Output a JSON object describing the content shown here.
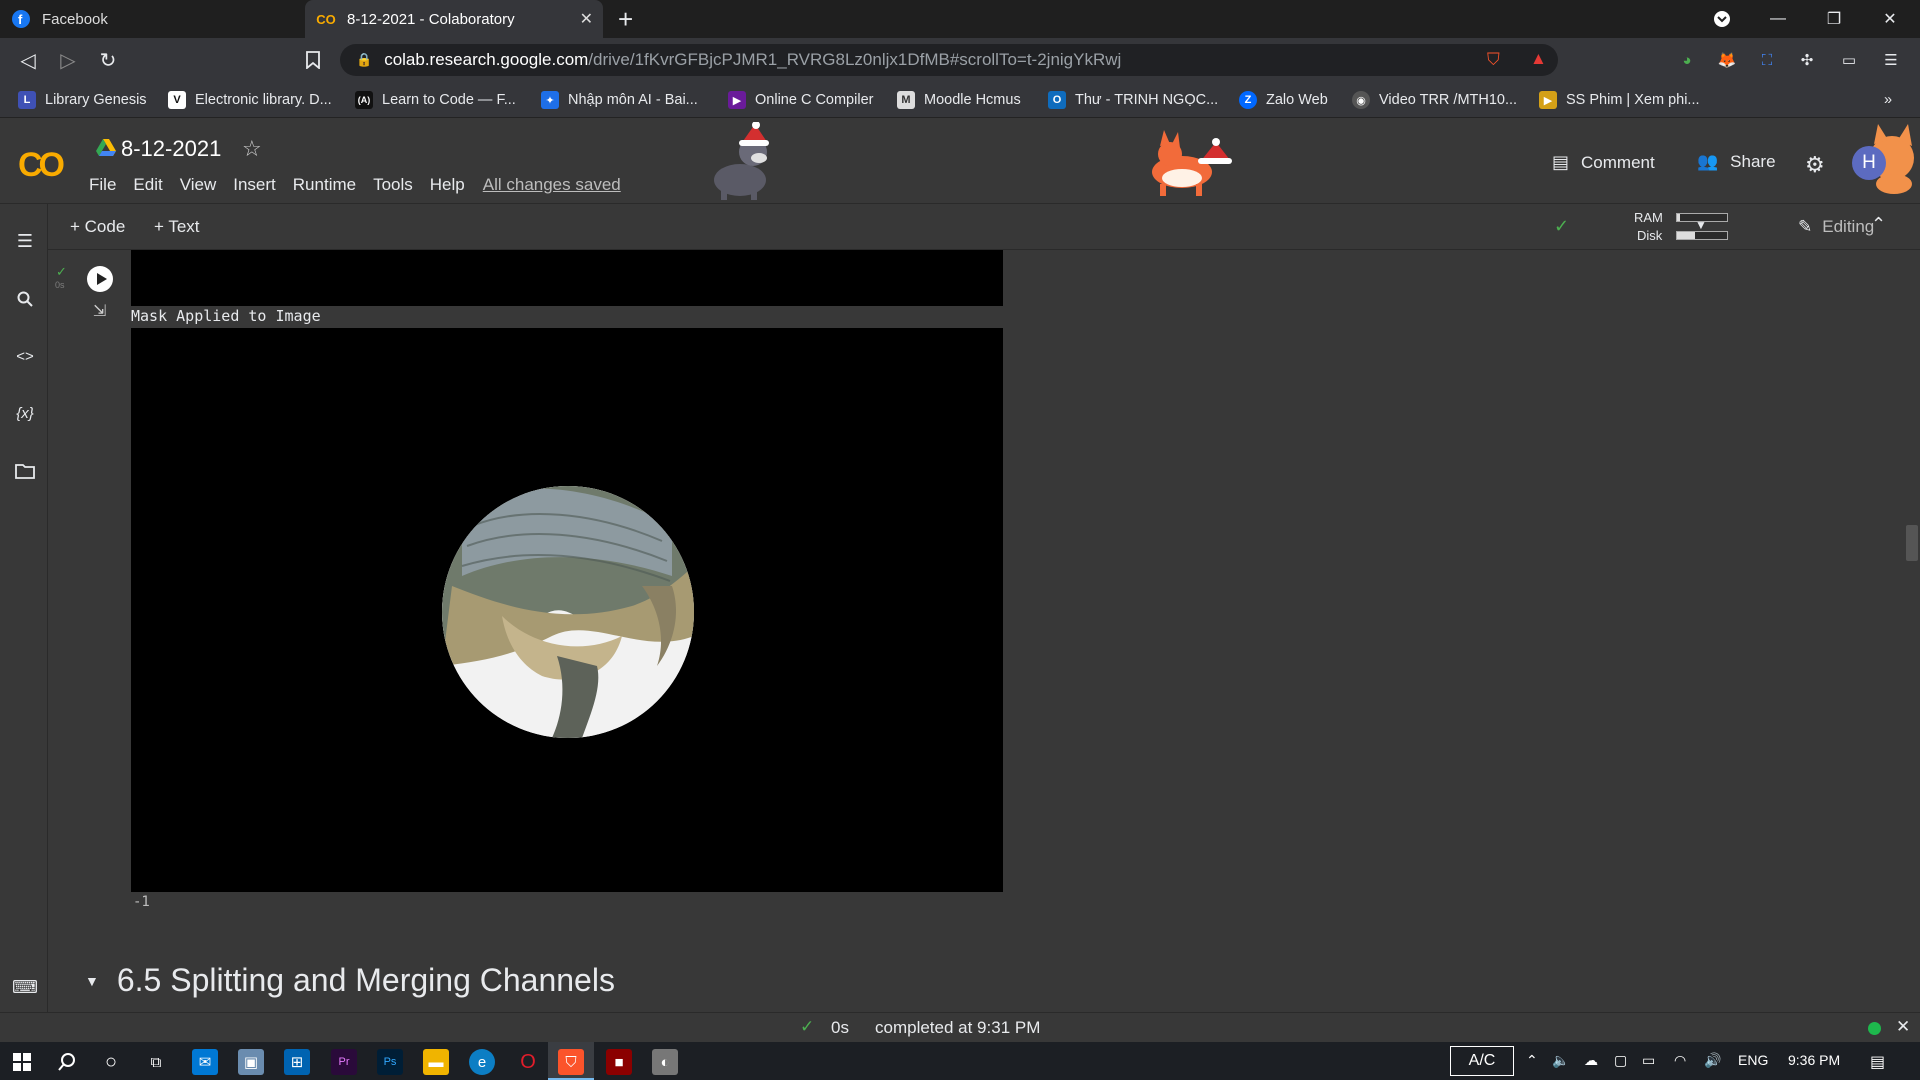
{
  "browser": {
    "tabs": [
      {
        "title": "Facebook",
        "active": false
      },
      {
        "title": "8-12-2021 - Colaboratory",
        "active": true
      }
    ],
    "url_host": "colab.research.google.com",
    "url_path": "/drive/1fKvrGFBjcPJMR1_RVRG8Lz0nljx1DfMB#scrollTo=t-2jnigYkRwj",
    "bookmarks": [
      {
        "label": "Library Genesis",
        "color": "#3f51b5",
        "glyph": "L"
      },
      {
        "label": "Electronic library. D...",
        "color": "#ffffff",
        "glyph": "V"
      },
      {
        "label": "Learn to Code — F...",
        "color": "#111111",
        "glyph": "(A)"
      },
      {
        "label": "Nhập môn AI - Bai...",
        "color": "#1e6fe8",
        "glyph": "✦"
      },
      {
        "label": "Online C Compiler",
        "color": "#6a1b9a",
        "glyph": "▶"
      },
      {
        "label": "Moodle Hcmus",
        "color": "#dddddd",
        "glyph": "M"
      },
      {
        "label": "Thư - TRINH NGỌC...",
        "color": "#0f6cbd",
        "glyph": "O"
      },
      {
        "label": "Zalo Web",
        "color": "#0068ff",
        "glyph": "Z"
      },
      {
        "label": "Video TRR /MTH10...",
        "color": "#555555",
        "glyph": "◉"
      },
      {
        "label": "SS Phim | Xem phi...",
        "color": "#d4a017",
        "glyph": "▶"
      }
    ],
    "more_bookmarks": "»"
  },
  "colab": {
    "notebook_title": "8-12-2021",
    "menu": [
      "File",
      "Edit",
      "View",
      "Insert",
      "Runtime",
      "Tools",
      "Help"
    ],
    "save_status": "All changes saved",
    "comment_label": "Comment",
    "share_label": "Share",
    "avatar_letter": "H",
    "add_code": "+ Code",
    "add_text": "+ Text",
    "ram_label": "RAM",
    "disk_label": "Disk",
    "ram_usage": 0.05,
    "disk_usage": 0.35,
    "editing_label": "Editing"
  },
  "cell": {
    "exec_time": "0s",
    "output_label": "Mask Applied to Image",
    "return_value": "-1"
  },
  "section": {
    "title": "6.5 Splitting and Merging Channels"
  },
  "statusbar": {
    "duration": "0s",
    "message": "completed at 9:31 PM"
  },
  "taskbar": {
    "ac_label": "A/C",
    "language": "ENG",
    "time": "9:36 PM"
  }
}
